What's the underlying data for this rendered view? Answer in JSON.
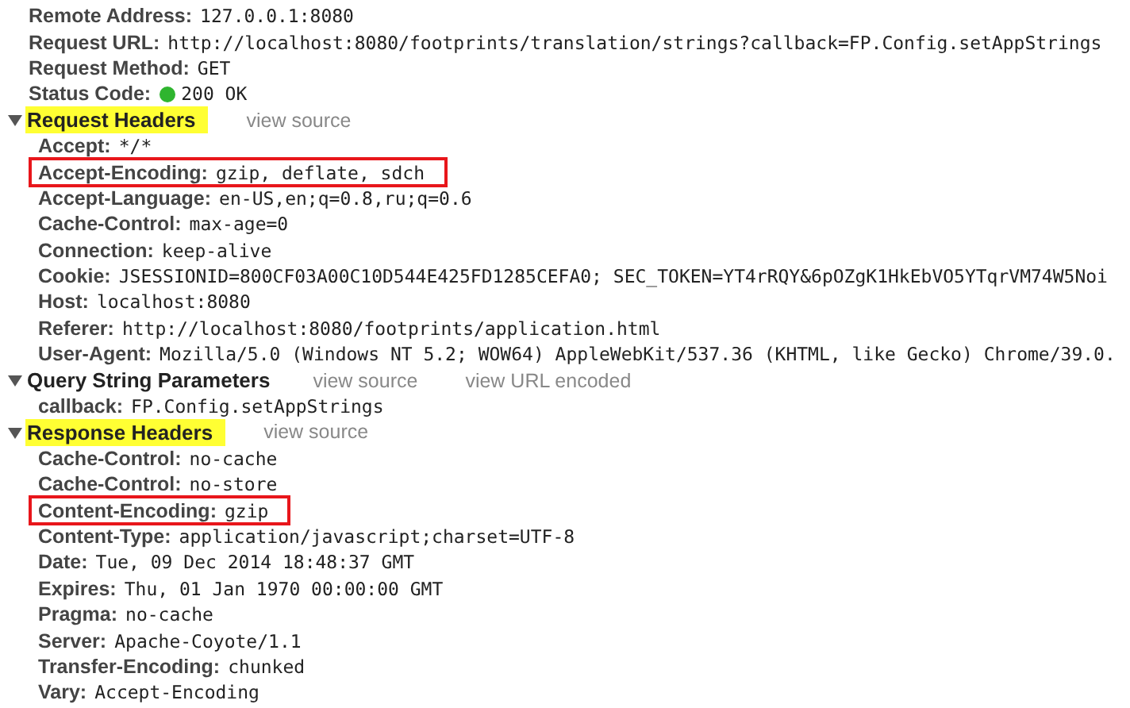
{
  "general": [
    {
      "name": "Remote Address:",
      "value": "127.0.0.1:8080",
      "kind": "text"
    },
    {
      "name": "Request URL:",
      "value": "http://localhost:8080/footprints/translation/strings?callback=FP.Config.setAppStrings",
      "kind": "text"
    },
    {
      "name": "Request Method:",
      "value": "GET",
      "kind": "text"
    },
    {
      "name": "Status Code:",
      "value": "200 OK",
      "kind": "status"
    }
  ],
  "sections": [
    {
      "title": "Request Headers",
      "expanded": true,
      "highlighted": true,
      "links": [
        "view source"
      ],
      "rows": [
        {
          "name": "Accept:",
          "value": "*/*",
          "boxed": false
        },
        {
          "name": "Accept-Encoding:",
          "value": "gzip, deflate, sdch",
          "boxed": true
        },
        {
          "name": "Accept-Language:",
          "value": "en-US,en;q=0.8,ru;q=0.6",
          "boxed": false
        },
        {
          "name": "Cache-Control:",
          "value": "max-age=0",
          "boxed": false
        },
        {
          "name": "Connection:",
          "value": "keep-alive",
          "boxed": false
        },
        {
          "name": "Cookie:",
          "value": "JSESSIONID=800CF03A00C10D544E425FD1285CEFA0; SEC_TOKEN=YT4rRQY&6pOZgK1HkEbVO5YTqrVM74W5Noi",
          "boxed": false
        },
        {
          "name": "Host:",
          "value": "localhost:8080",
          "boxed": false
        },
        {
          "name": "Referer:",
          "value": "http://localhost:8080/footprints/application.html",
          "boxed": false
        },
        {
          "name": "User-Agent:",
          "value": "Mozilla/5.0 (Windows NT 5.2; WOW64) AppleWebKit/537.36 (KHTML, like Gecko) Chrome/39.0.",
          "boxed": false
        }
      ]
    },
    {
      "title": "Query String Parameters",
      "expanded": true,
      "highlighted": false,
      "links": [
        "view source",
        "view URL encoded"
      ],
      "rows": [
        {
          "name": "callback:",
          "value": "FP.Config.setAppStrings",
          "boxed": false
        }
      ]
    },
    {
      "title": "Response Headers",
      "expanded": true,
      "highlighted": true,
      "links": [
        "view source"
      ],
      "rows": [
        {
          "name": "Cache-Control:",
          "value": "no-cache",
          "boxed": false
        },
        {
          "name": "Cache-Control:",
          "value": "no-store",
          "boxed": false
        },
        {
          "name": "Content-Encoding:",
          "value": "gzip",
          "boxed": true
        },
        {
          "name": "Content-Type:",
          "value": "application/javascript;charset=UTF-8",
          "boxed": false
        },
        {
          "name": "Date:",
          "value": "Tue, 09 Dec 2014 18:48:37 GMT",
          "boxed": false
        },
        {
          "name": "Expires:",
          "value": "Thu, 01 Jan 1970 00:00:00 GMT",
          "boxed": false
        },
        {
          "name": "Pragma:",
          "value": "no-cache",
          "boxed": false
        },
        {
          "name": "Server:",
          "value": "Apache-Coyote/1.1",
          "boxed": false
        },
        {
          "name": "Transfer-Encoding:",
          "value": "chunked",
          "boxed": false
        },
        {
          "name": "Vary:",
          "value": "Accept-Encoding",
          "boxed": false
        }
      ]
    }
  ]
}
